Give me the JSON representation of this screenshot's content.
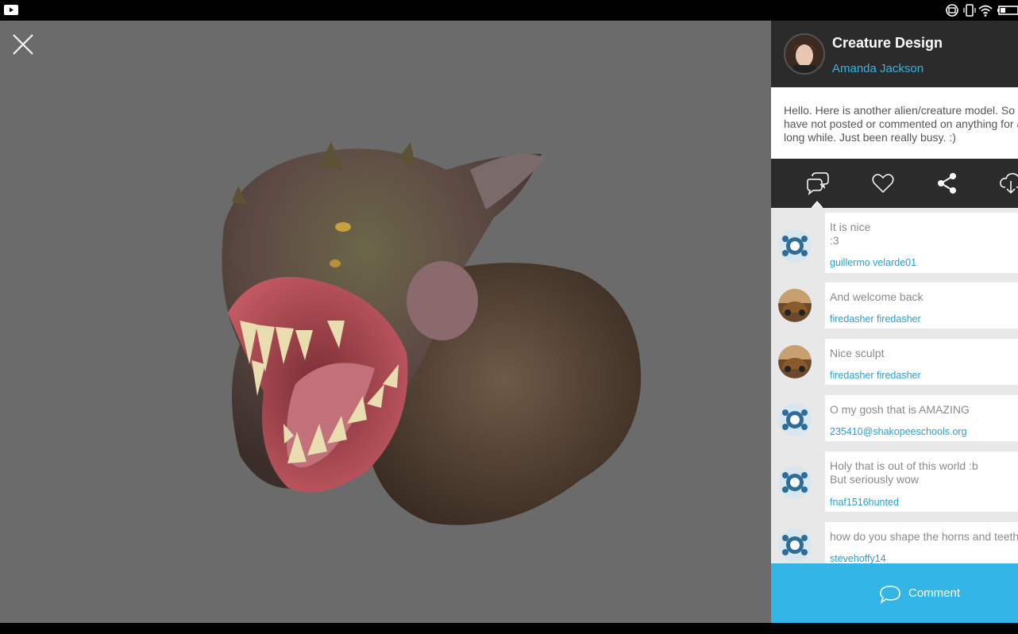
{
  "model": {
    "title": "Creature Design",
    "author": "Amanda Jackson",
    "description": "Hello.  Here is another alien/creature model. So I have not posted or commented on anything for a long while. Just been really busy. :)"
  },
  "actions": [
    {
      "name": "comments-tab",
      "icon": "speech-bubbles-icon"
    },
    {
      "name": "like-button",
      "icon": "heart-icon"
    },
    {
      "name": "share-button",
      "icon": "share-icon"
    },
    {
      "name": "download-button",
      "icon": "cloud-download-icon"
    }
  ],
  "comments": [
    {
      "text": "It is nice\n:3",
      "user": "guillermo velarde01",
      "avatar": "turtle-avatar"
    },
    {
      "text": "And welcome back",
      "user": "firedasher firedasher",
      "avatar": "car-avatar"
    },
    {
      "text": "Nice sculpt",
      "user": "firedasher firedasher",
      "avatar": "car-avatar"
    },
    {
      "text": "O my gosh that is AMAZING",
      "user": "235410@shakopeeschools.org",
      "avatar": "turtle-avatar"
    },
    {
      "text": "Holy that is out of this world :b\nBut seriously wow",
      "user": "fnaf1516hunted",
      "avatar": "turtle-avatar"
    },
    {
      "text": "how do you shape the horns and teeth",
      "user": "stevehoffy14",
      "avatar": "turtle-avatar"
    }
  ],
  "comment_button": {
    "label": "Comment"
  },
  "colors": {
    "accent": "#33b5e5",
    "panel_dark": "#2b2b2b",
    "viewer_bg": "#6b6b6b"
  }
}
